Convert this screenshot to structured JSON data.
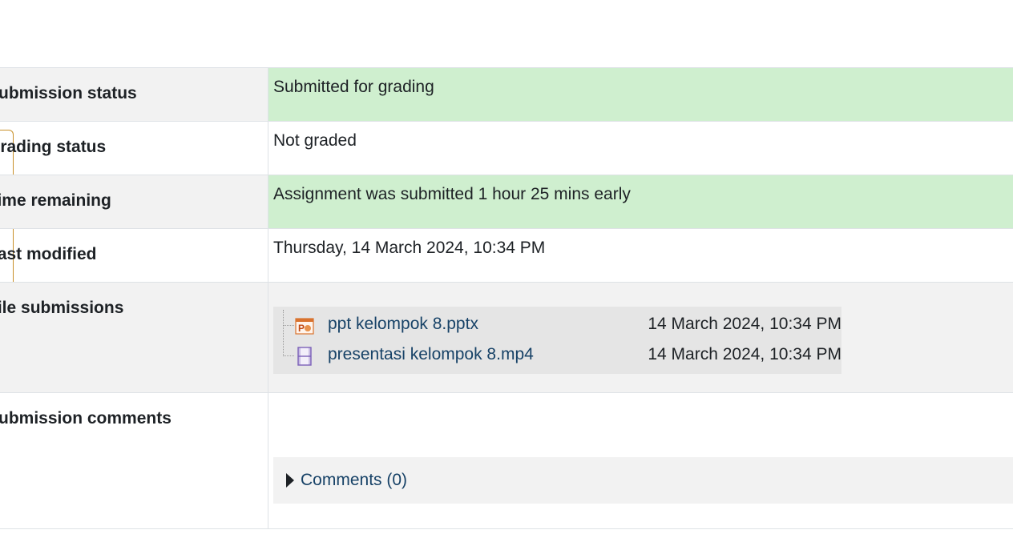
{
  "status_table": {
    "rows": [
      {
        "label": "Submission status",
        "value": "Submitted for grading"
      },
      {
        "label": "Grading status",
        "value": "Not graded"
      },
      {
        "label": "Time remaining",
        "value": "Assignment was submitted 1 hour 25 mins early"
      },
      {
        "label": "Last modified",
        "value": "Thursday, 14 March 2024, 10:34 PM"
      },
      {
        "label": "File submissions"
      },
      {
        "label": "Submission comments"
      }
    ]
  },
  "files": [
    {
      "name": "ppt kelompok 8.pptx",
      "date": "14 March 2024, 10:34 PM",
      "icon": "powerpoint-file-icon"
    },
    {
      "name": "presentasi kelompok 8.mp4",
      "date": "14 March 2024, 10:34 PM",
      "icon": "video-file-icon"
    }
  ],
  "comments": {
    "label": "Comments (0)"
  },
  "colors": {
    "success_bg": "#cfefcf",
    "shaded_bg": "#f2f2f2",
    "link": "#174267",
    "frame_accent": "#c8902a"
  }
}
